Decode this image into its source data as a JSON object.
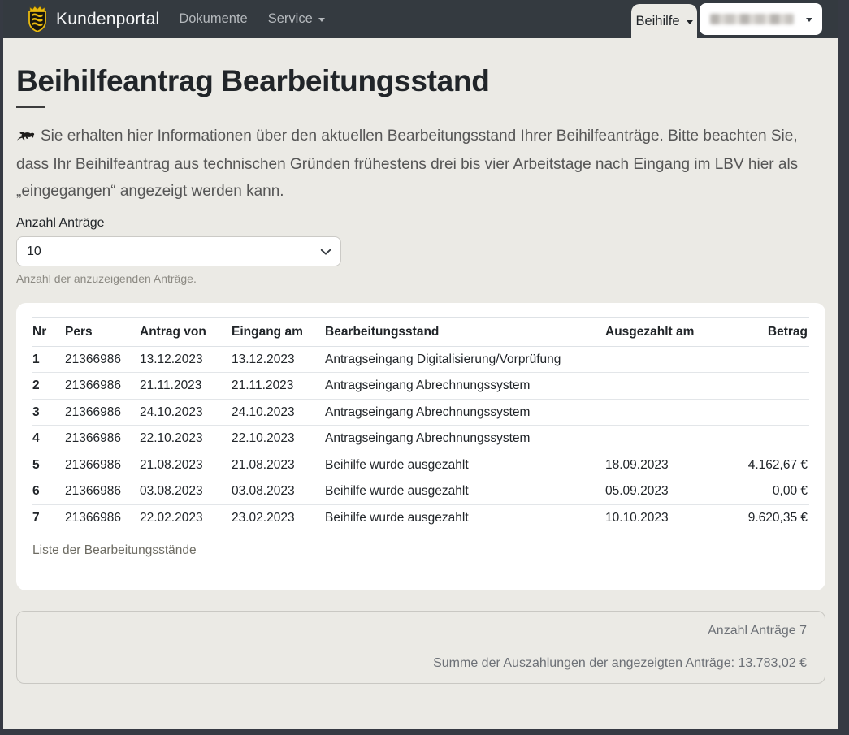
{
  "navbar": {
    "brand": "Kundenportal",
    "links": [
      {
        "label": "Dokumente",
        "has_caret": false
      },
      {
        "label": "Service",
        "has_caret": true
      }
    ],
    "active_tab": "Beihilfe",
    "user_menu_redacted": true
  },
  "page": {
    "title": "Beihilfeantrag Bearbeitungsstand",
    "intro": "Sie erhalten hier Informationen über den aktuellen Bearbeitungsstand Ihrer Beihilfeanträge. Bitte beachten Sie, dass Ihr Beihilfeantrag aus technischen Gründen frühestens drei bis vier Arbeitstage nach Eingang im LBV hier als „eingegangen“ angezeigt werden kann."
  },
  "filter": {
    "label": "Anzahl Anträge",
    "selected_value": "10",
    "help_text": "Anzahl der anzuzeigenden Anträge."
  },
  "table": {
    "columns": [
      "Nr",
      "Pers",
      "Antrag von",
      "Eingang am",
      "Bearbeitungsstand",
      "Ausgezahlt am",
      "Betrag"
    ],
    "rows": [
      [
        "1",
        "21366986",
        "13.12.2023",
        "13.12.2023",
        "Antragseingang Digitalisierung/Vorprüfung",
        "",
        ""
      ],
      [
        "2",
        "21366986",
        "21.11.2023",
        "21.11.2023",
        "Antragseingang Abrechnungssystem",
        "",
        ""
      ],
      [
        "3",
        "21366986",
        "24.10.2023",
        "24.10.2023",
        "Antragseingang Abrechnungssystem",
        "",
        ""
      ],
      [
        "4",
        "21366986",
        "22.10.2023",
        "22.10.2023",
        "Antragseingang Abrechnungssystem",
        "",
        ""
      ],
      [
        "5",
        "21366986",
        "21.08.2023",
        "21.08.2023",
        "Beihilfe wurde ausgezahlt",
        "18.09.2023",
        "4.162,67 €"
      ],
      [
        "6",
        "21366986",
        "03.08.2023",
        "03.08.2023",
        "Beihilfe wurde ausgezahlt",
        "05.09.2023",
        "0,00 €"
      ],
      [
        "7",
        "21366986",
        "22.02.2023",
        "23.02.2023",
        "Beihilfe wurde ausgezahlt",
        "10.10.2023",
        "9.620,35 €"
      ]
    ],
    "caption": "Liste der Bearbeitungsstände"
  },
  "summary": {
    "count_line": "Anzahl Anträge 7",
    "sum_line": "Summe der Auszahlungen der angezeigten Anträge: 13.783,02 €"
  },
  "colors": {
    "navbar_bg": "#343a40",
    "page_bg": "#ebeae5",
    "frame_dark": "#363a43",
    "card_bg": "#ffffff",
    "text_dark": "#212529",
    "text_muted": "#6c7076",
    "coat_of_arms_gold": "#e8b90f"
  }
}
